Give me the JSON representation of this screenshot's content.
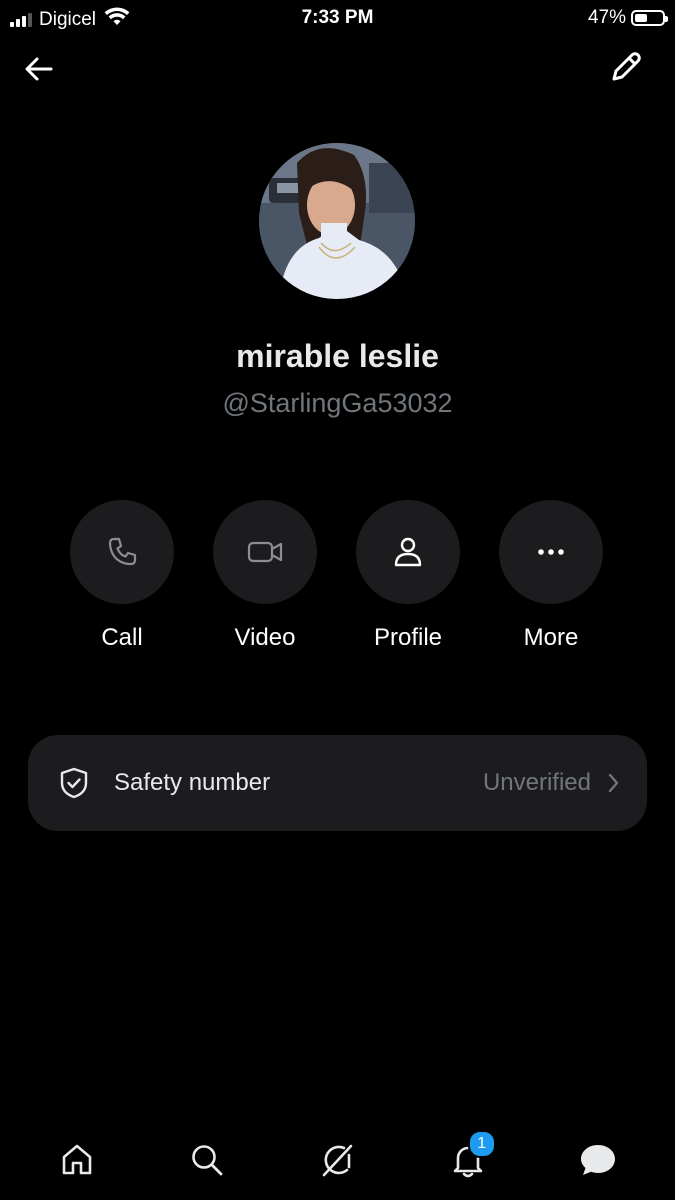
{
  "status_bar": {
    "carrier": "Digicel",
    "time": "7:33 PM",
    "battery_percent": "47%",
    "battery_level": 0.47
  },
  "header": {
    "back_icon": "arrow-left-icon",
    "edit_icon": "pencil-icon"
  },
  "profile": {
    "display_name": "mirable leslie",
    "handle": "@StarlingGa53032"
  },
  "actions": [
    {
      "label": "Call",
      "icon": "phone-icon"
    },
    {
      "label": "Video",
      "icon": "video-camera-icon"
    },
    {
      "label": "Profile",
      "icon": "person-icon"
    },
    {
      "label": "More",
      "icon": "more-dots-icon"
    }
  ],
  "safety": {
    "label": "Safety number",
    "status": "Unverified",
    "icon": "shield-check-icon"
  },
  "tab_bar": {
    "tabs": [
      {
        "icon": "home-icon"
      },
      {
        "icon": "search-icon"
      },
      {
        "icon": "grok-icon"
      },
      {
        "icon": "bell-icon",
        "badge": "1"
      },
      {
        "icon": "messages-icon"
      }
    ]
  },
  "colors": {
    "background": "#000000",
    "surface": "#1c1c1e",
    "muted_text": "#71767b",
    "accent": "#1d9bf0"
  }
}
